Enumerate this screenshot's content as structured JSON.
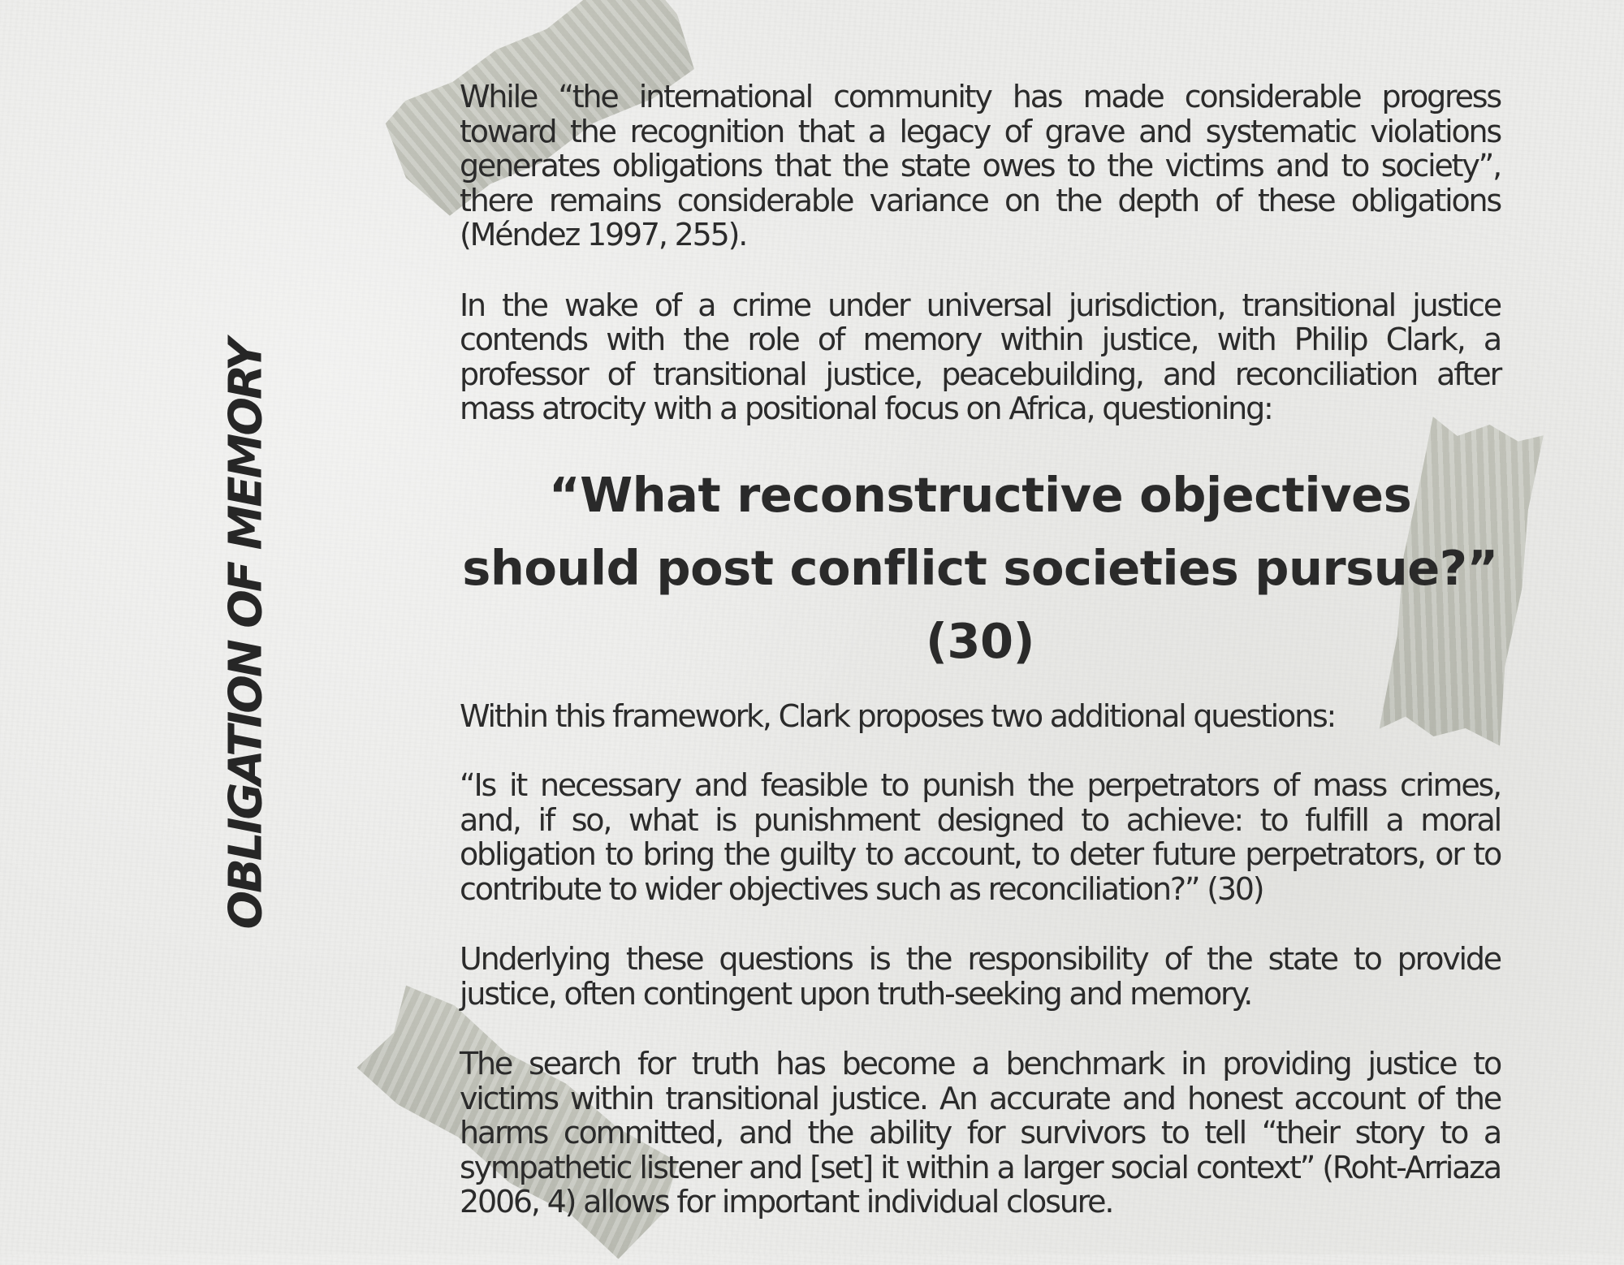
{
  "side_title": "OBLIGATION OF MEMORY",
  "paragraphs": [
    "While “the international community has made considerable progress toward the recognition that a legacy of grave and systematic violations generates obligations that the state owes to the victims and to society”, there remains considerable variance on the depth of these obligations (Méndez 1997, 255).",
    "In the wake of a crime under universal jurisdiction, transitional justice contends with the role of memory within justice, with Philip Clark, a professor of transitional justice, peacebuilding, and reconciliation after mass atrocity with a positional focus on Africa, questioning:"
  ],
  "highlight_quote": "“What reconstructive objectives should post conflict societies pursue?” (30)",
  "paragraphs_after": [
    "Within this framework, Clark proposes two additional questions:",
    "“Is it necessary and feasible to punish the perpetrators of mass crimes, and, if so, what is punishment designed to achieve: to fulfill a moral obligation to bring the guilty to account, to deter future perpetrators, or to contribute to wider objectives such as reconciliation?” (30)",
    "Underlying these questions is the responsibility of the state to provide justice, often contingent upon truth-seeking and memory.",
    "The search for truth has become a benchmark in providing justice to victims within transitional justice. An accurate and honest account of the harms committed, and the ability for survivors to tell “their story to a sympathetic listener and [set] it within a larger social context” (Roht-Arriaza 2006, 4) allows for important individual closure."
  ]
}
